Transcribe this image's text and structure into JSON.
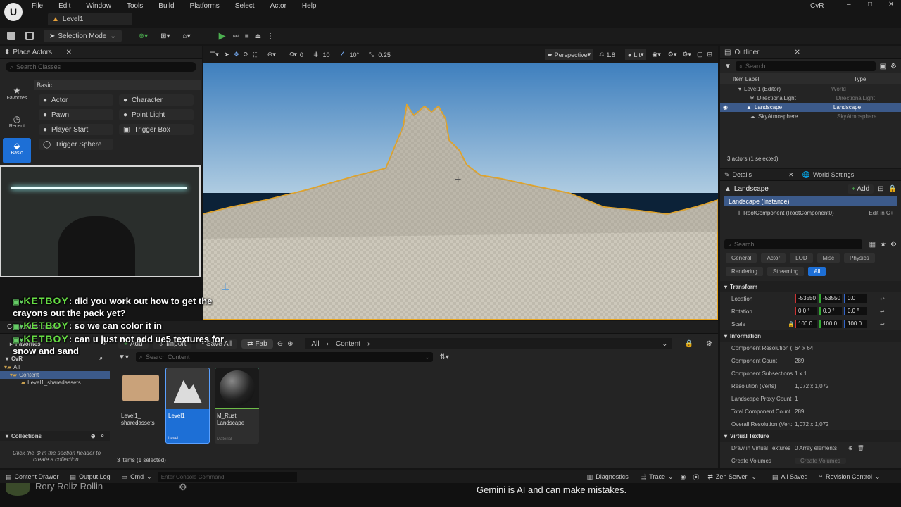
{
  "menu": [
    "File",
    "Edit",
    "Window",
    "Tools",
    "Build",
    "Platforms",
    "Select",
    "Actor",
    "Help"
  ],
  "project": "CvR",
  "level_tab": "Level1",
  "toolbar": {
    "selection_mode": "Selection Mode"
  },
  "place_actors": {
    "title": "Place Actors",
    "search_placeholder": "Search Classes",
    "category": "Basic",
    "side": [
      {
        "label": "Favorites",
        "icon": "star-icon"
      },
      {
        "label": "Recent",
        "icon": "clock-icon"
      },
      {
        "label": "Basic",
        "icon": "basic-shapes-icon"
      }
    ],
    "actors": [
      "Actor",
      "Character",
      "Pawn",
      "Point Light",
      "Player Start",
      "Trigger Box",
      "Trigger Sphere"
    ]
  },
  "viewport": {
    "perspective": "Perspective",
    "lit": "Lit",
    "grid": "10",
    "angle": "10°",
    "scale": "0.25",
    "camera": "1.8",
    "snap": "0"
  },
  "outliner": {
    "title": "Outliner",
    "search_placeholder": "Search...",
    "col_label": "Item Label",
    "col_type": "Type",
    "rows": [
      {
        "label": "Level1 (Editor)",
        "type": "World"
      },
      {
        "label": "DirectionalLight",
        "type": "DirectionalLight"
      },
      {
        "label": "Landscape",
        "type": "Landscape"
      },
      {
        "label": "SkyAtmosphere",
        "type": "SkyAtmosphere"
      }
    ],
    "status": "3 actors (1 selected)"
  },
  "details": {
    "title": "Details",
    "world_settings": "World Settings",
    "object": "Landscape",
    "add": "Add",
    "instance": "Landscape (Instance)",
    "root": "RootComponent (RootComponent0)",
    "edit_cpp": "Edit in C++",
    "search_placeholder": "Search",
    "tabs": [
      "General",
      "Actor",
      "LOD",
      "Misc",
      "Physics",
      "Rendering",
      "Streaming",
      "All"
    ],
    "transform": "Transform",
    "location": {
      "label": "Location",
      "x": "-53550",
      "y": "-53550",
      "z": "0.0"
    },
    "rotation": {
      "label": "Rotation",
      "x": "0.0 °",
      "y": "0.0 °",
      "z": "0.0 °"
    },
    "scale": {
      "label": "Scale",
      "x": "100.0",
      "y": "100.0",
      "z": "100.0"
    },
    "information": "Information",
    "info": [
      {
        "k": "Component Resolution (",
        "v": "64 x 64"
      },
      {
        "k": "Component Count",
        "v": "289"
      },
      {
        "k": "Component Subsections",
        "v": "1 x 1"
      },
      {
        "k": "Resolution (Verts)",
        "v": "1,072 x 1,072"
      },
      {
        "k": "Landscape Proxy Count",
        "v": "1"
      },
      {
        "k": "Total Component Count",
        "v": "289"
      },
      {
        "k": "Overall Resolution (Vert:",
        "v": "1,072 x 1,072"
      }
    ],
    "virtual_texture": "Virtual Texture",
    "vt_rows": [
      {
        "k": "Draw in Virtual Textures",
        "v": "0 Array elements"
      },
      {
        "k": "Create Volumes",
        "v": "Create Volumes"
      }
    ]
  },
  "content_browser": {
    "title": "Content Browser",
    "add": "Add",
    "import": "Import",
    "save_all": "Save All",
    "fab": "Fab",
    "path": [
      "All",
      "Content"
    ],
    "search_placeholder": "Search Content",
    "favorites": "Favorites",
    "project": "CvR",
    "tree": [
      "All",
      "Content",
      "Level1_sharedassets"
    ],
    "collections": "Collections",
    "hint_pre": "Click the",
    "hint_post": "in the section header to create a collection.",
    "assets": [
      {
        "name": "Level1_ sharedassets",
        "type": ""
      },
      {
        "name": "Level1",
        "type": "Level"
      },
      {
        "name": "M_Rust Landscape",
        "type": "Material"
      }
    ],
    "status": "3 items (1 selected)"
  },
  "statusbar": {
    "drawer": "Content Drawer",
    "output": "Output Log",
    "cmd": "Cmd",
    "console_placeholder": "Enter Console Command",
    "diagnostics": "Diagnostics",
    "trace": "Trace",
    "zen": "Zen Server",
    "saved": "All Saved",
    "revision": "Revision Control"
  },
  "chat": [
    {
      "nick": "KETBOY",
      "msg": ": did you work out how to get the crayons out the pack yet?"
    },
    {
      "nick": "KETBOY",
      "msg": ": so we can color it in"
    },
    {
      "nick": "KETBOY",
      "msg": ": can u just not add ue5 textures for snow and sand"
    }
  ],
  "overlay_names": "Rory  Roliz  Rollin",
  "gemini_notice": "Gemini is AI and can make mistakes."
}
